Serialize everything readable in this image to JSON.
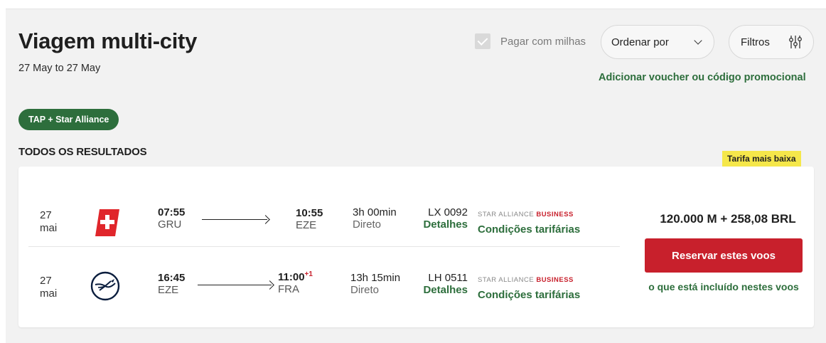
{
  "header": {
    "title": "Viagem multi-city",
    "dates": "27 May to 27 May"
  },
  "controls": {
    "pay_with_miles_label": "Pagar com milhas",
    "pay_with_miles_checked": true,
    "sort_label": "Ordenar por",
    "filters_label": "Filtros",
    "voucher_link": "Adicionar voucher ou código promocional"
  },
  "alliance_pill": "TAP + Star Alliance",
  "results_heading": "TODOS OS RESULTADOS",
  "badge": "Tarifa mais baixa",
  "card": {
    "segments": [
      {
        "day": "27",
        "month": "mai",
        "airline_icon": "swiss-logo-icon",
        "dep_time": "07:55",
        "dep_code": "GRU",
        "arr_time": "10:55",
        "arr_day_offset": "",
        "arr_code": "EZE",
        "duration": "3h 00min",
        "stops": "Direto",
        "flight_number": "LX 0092",
        "details_link": "Detalhes",
        "alliance_text": "STAR ALLIANCE",
        "cabin": "BUSINESS",
        "fare_conditions": "Condições tarifárias"
      },
      {
        "day": "27",
        "month": "mai",
        "airline_icon": "lufthansa-logo-icon",
        "dep_time": "16:45",
        "dep_code": "EZE",
        "arr_time": "11:00",
        "arr_day_offset": "+1",
        "arr_code": "FRA",
        "duration": "13h 15min",
        "stops": "Direto",
        "flight_number": "LH 0511",
        "details_link": "Detalhes",
        "alliance_text": "STAR ALLIANCE",
        "cabin": "BUSINESS",
        "fare_conditions": "Condições tarifárias"
      }
    ],
    "price": "120.000 M + 258,08 BRL",
    "book_button": "Reservar estes voos",
    "included_link": "o que está incluído nestes voos"
  },
  "colors": {
    "brand_green": "#2d6e3c",
    "brand_red": "#c8202c",
    "badge_yellow": "#f5e74a"
  }
}
